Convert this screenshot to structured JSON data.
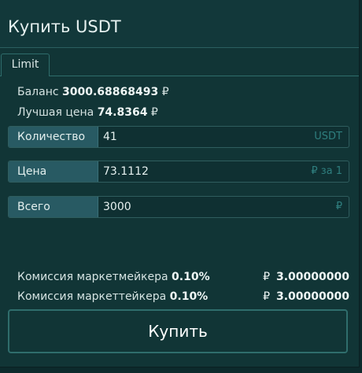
{
  "title": "Купить USDT",
  "tabs": [
    {
      "label": "Limit"
    }
  ],
  "balance": {
    "label": "Баланс",
    "value": "3000.68868493",
    "currency": "₽"
  },
  "best_price": {
    "label": "Лучшая цена",
    "value": "74.8364",
    "currency": "₽"
  },
  "fields": {
    "quantity": {
      "label": "Количество",
      "value": "41",
      "unit": "USDT"
    },
    "price": {
      "label": "Цена",
      "value": "73.1112",
      "unit": "₽ за 1"
    },
    "total": {
      "label": "Всего",
      "value": "3000",
      "unit": "₽"
    }
  },
  "fees": {
    "maker": {
      "label": "Комиссия маркетмейкера",
      "percent": "0.10%",
      "currency": "₽",
      "amount": "3.00000000"
    },
    "taker": {
      "label": "Комиссия маркеттейкера",
      "percent": "0.10%",
      "currency": "₽",
      "amount": "3.00000000"
    }
  },
  "buy_button": {
    "label": "Купить"
  },
  "colors": {
    "panel": "#113536",
    "accent": "#2f6d6c",
    "label_bg": "#285a63",
    "unit_text": "#2f7f7f"
  }
}
